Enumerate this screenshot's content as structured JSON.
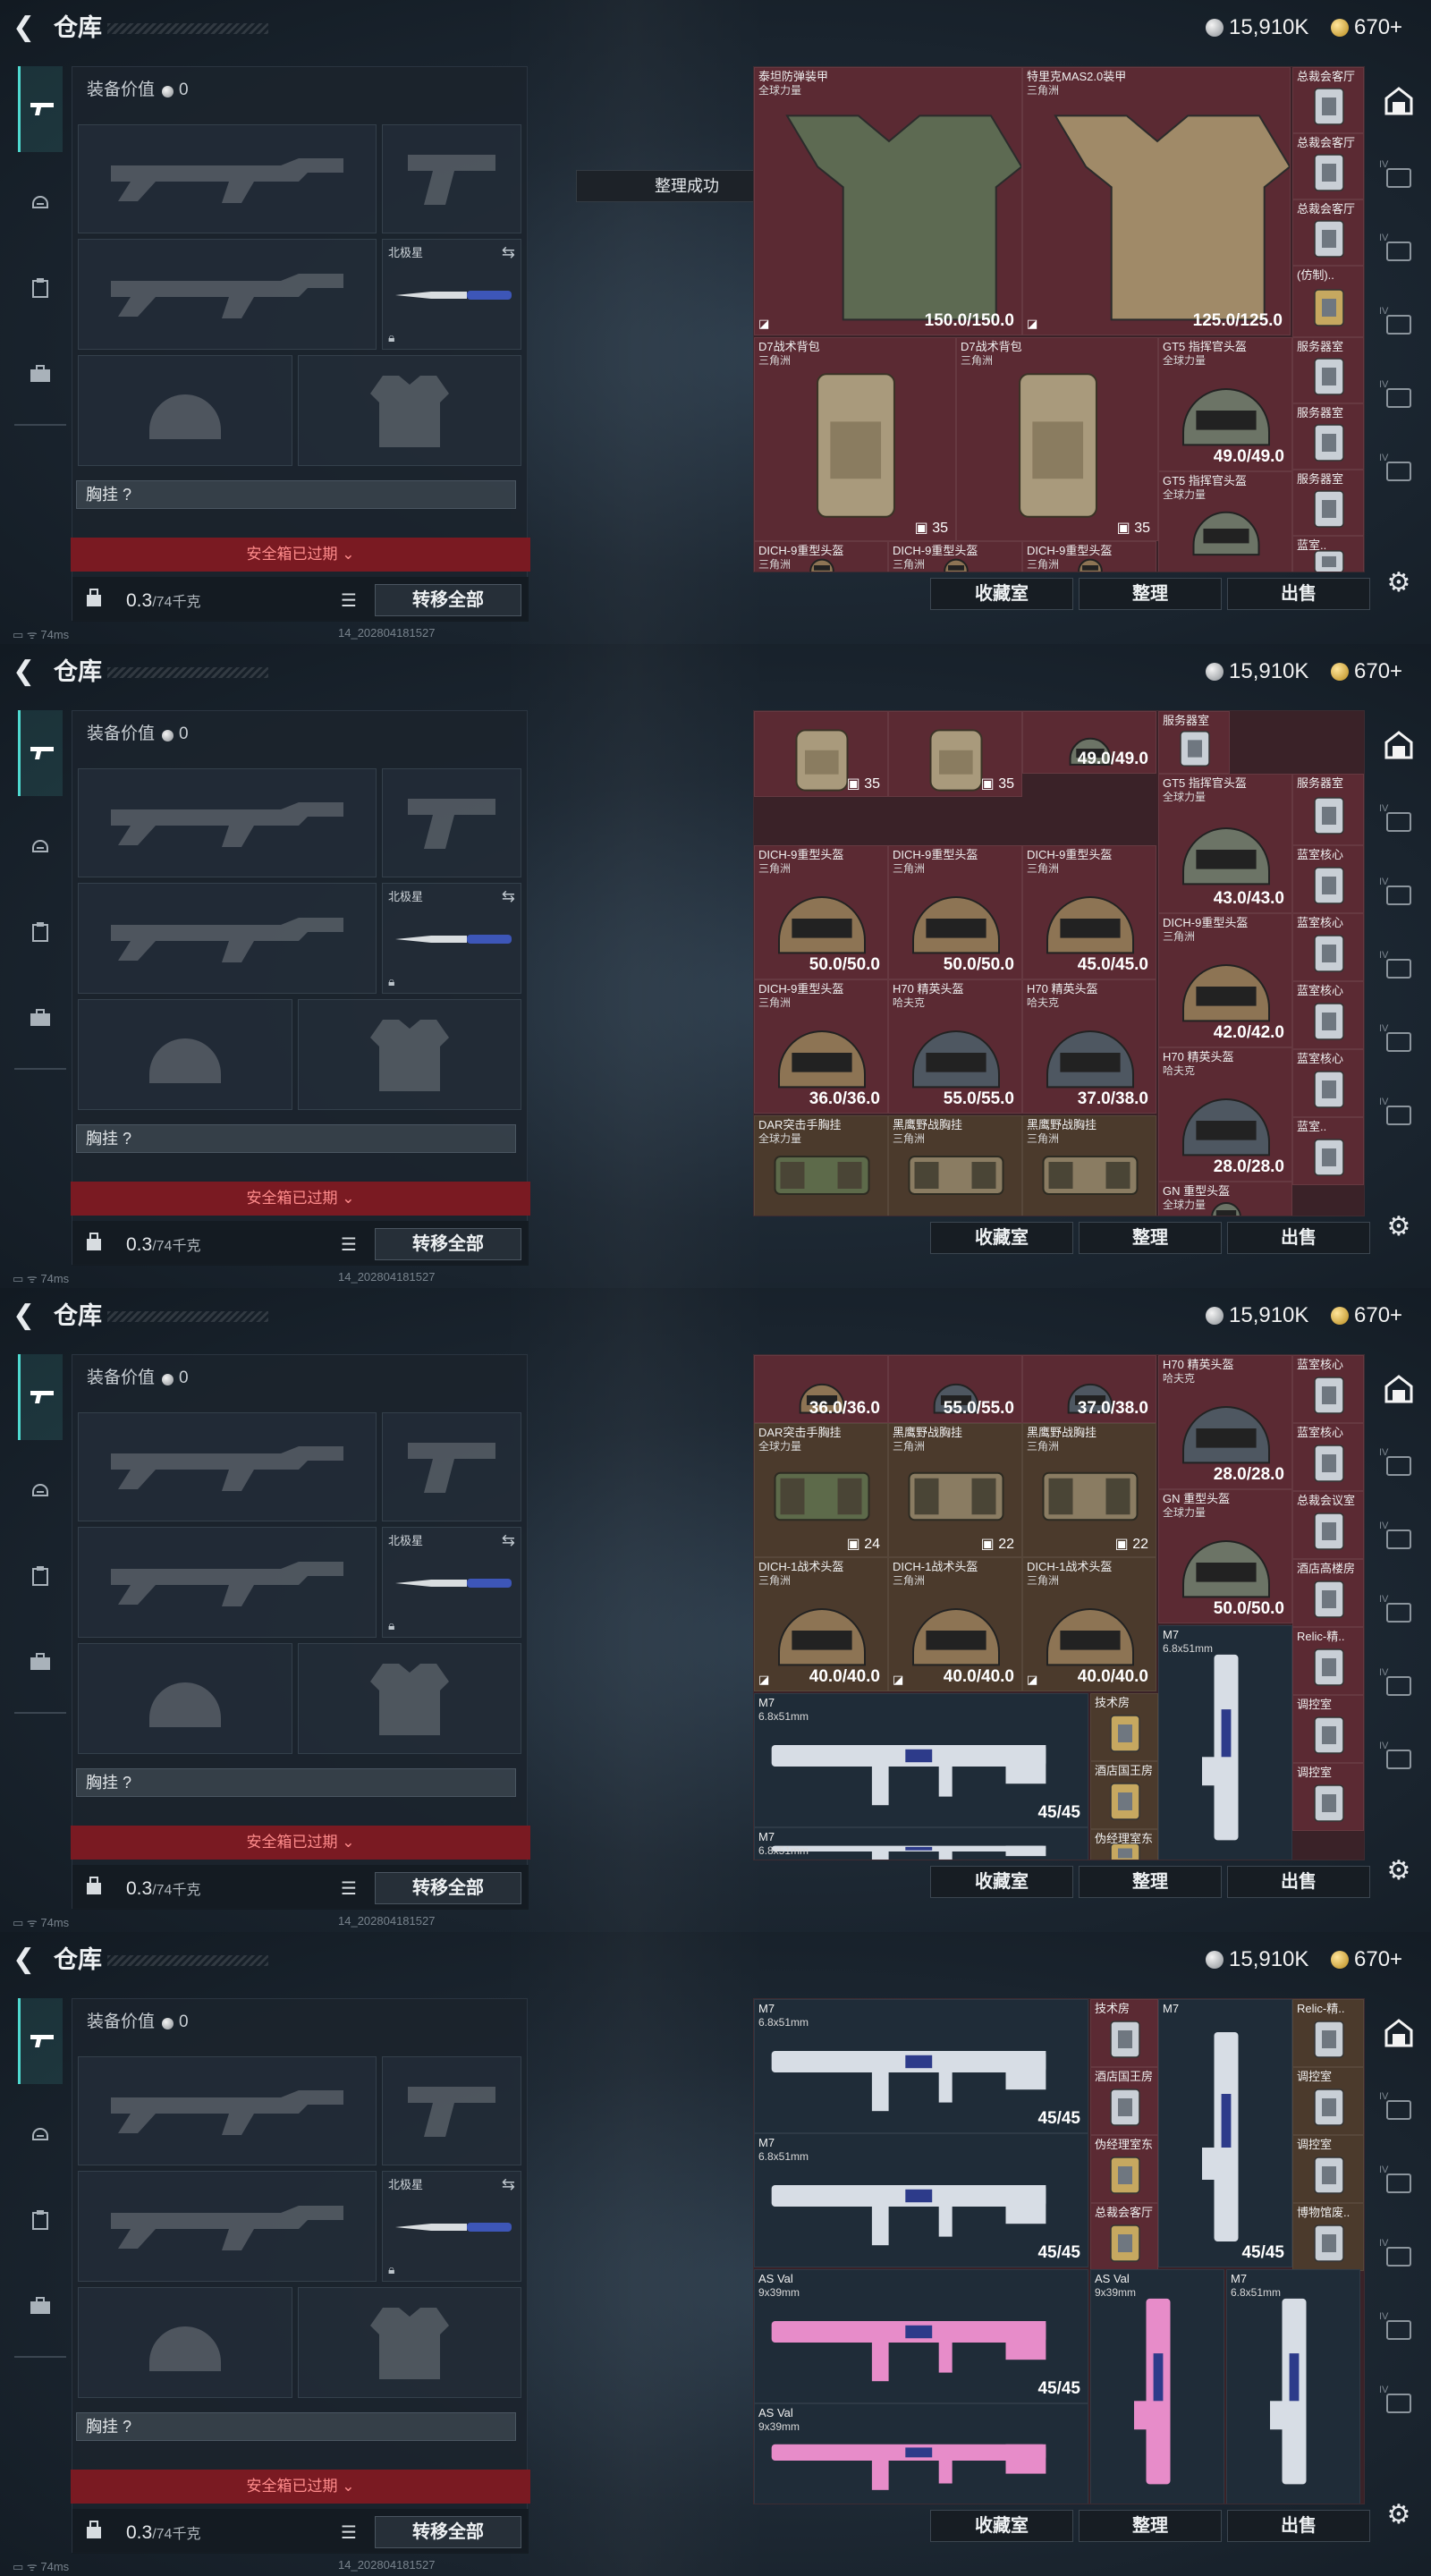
{
  "header": {
    "title": "仓库",
    "currency_silver": "15,910K",
    "currency_gold": "670+",
    "back_label": "❮"
  },
  "loadout": {
    "equip_value_label": "装备价值",
    "equip_value": "0",
    "secondary_name": "北极星",
    "vest_label": "胸挂",
    "vest_value": "?",
    "safebox_label": "安全箱已过期 ⌄",
    "weight": "0.3",
    "weight_max": "/74千克",
    "move_all": "转移全部"
  },
  "toast": "整理成功",
  "status": {
    "ping": "74ms",
    "session_id": "14_202804181527"
  },
  "stash_buttons": {
    "collect": "收藏室",
    "sort": "整理",
    "sell": "出售"
  },
  "rail": {
    "level_label": "IV"
  },
  "frames": [
    {
      "show_toast": true,
      "cells": [
        {
          "name": "泰坦防弹装甲",
          "sub": "全球力量",
          "dur": "150.0/150.0",
          "color": "red",
          "kind": "armor_green",
          "mark": "◪"
        },
        {
          "name": "特里克MAS2.0装甲",
          "sub": "三角洲",
          "dur": "125.0/125.0",
          "color": "red",
          "kind": "armor_tan",
          "mark": "◪"
        },
        {
          "name": "总裁会客厅",
          "sub": "",
          "color": "red",
          "kind": "key"
        },
        {
          "name": "总裁会客厅",
          "sub": "",
          "color": "red",
          "kind": "key"
        },
        {
          "name": "总裁会客厅",
          "sub": "",
          "color": "red",
          "kind": "key"
        },
        {
          "name": "(仿制)..",
          "sub": "",
          "color": "red",
          "kind": "key_gold"
        },
        {
          "name": "D7战术背包",
          "sub": "三角洲",
          "count": "35",
          "color": "red",
          "kind": "backpack"
        },
        {
          "name": "D7战术背包",
          "sub": "三角洲",
          "count": "35",
          "color": "red",
          "kind": "backpack"
        },
        {
          "name": "GT5 指挥官头盔",
          "sub": "全球力量",
          "dur": "49.0/49.0",
          "color": "red",
          "kind": "helmet_green"
        },
        {
          "name": "服务器室",
          "sub": "",
          "color": "red",
          "kind": "key"
        },
        {
          "name": "服务器室",
          "sub": "",
          "color": "red",
          "kind": "key"
        },
        {
          "name": "GT5 指挥官头盔",
          "sub": "全球力量",
          "color": "red",
          "kind": "helmet_green"
        },
        {
          "name": "服务器室",
          "sub": "",
          "color": "red",
          "kind": "key"
        },
        {
          "name": "DICH-9重型头盔",
          "sub": "三角洲",
          "color": "red",
          "kind": "helmet_tan"
        },
        {
          "name": "DICH-9重型头盔",
          "sub": "三角洲",
          "color": "red",
          "kind": "helmet_tan"
        },
        {
          "name": "DICH-9重型头盔",
          "sub": "三角洲",
          "color": "red",
          "kind": "helmet_tan"
        },
        {
          "name": "蓝室..",
          "sub": "",
          "color": "red",
          "kind": "key"
        }
      ]
    },
    {
      "show_toast": false,
      "cells": [
        {
          "name": "",
          "sub": "",
          "count": "35",
          "color": "red",
          "kind": "backpack"
        },
        {
          "name": "",
          "sub": "",
          "count": "35",
          "color": "red",
          "kind": "backpack"
        },
        {
          "name": "",
          "sub": "",
          "dur": "49.0/49.0",
          "color": "red",
          "kind": "helmet_green"
        },
        {
          "name": "服务器室",
          "sub": "",
          "color": "red",
          "kind": "key"
        },
        {
          "name": "GT5 指挥官头盔",
          "sub": "全球力量",
          "dur": "43.0/43.0",
          "color": "red",
          "kind": "helmet_green"
        },
        {
          "name": "服务器室",
          "sub": "",
          "color": "red",
          "kind": "key"
        },
        {
          "name": "DICH-9重型头盔",
          "sub": "三角洲",
          "dur": "50.0/50.0",
          "color": "red",
          "kind": "helmet_tan"
        },
        {
          "name": "DICH-9重型头盔",
          "sub": "三角洲",
          "dur": "50.0/50.0",
          "color": "red",
          "kind": "helmet_tan"
        },
        {
          "name": "DICH-9重型头盔",
          "sub": "三角洲",
          "dur": "45.0/45.0",
          "color": "red",
          "kind": "helmet_tan"
        },
        {
          "name": "蓝室核心",
          "sub": "",
          "color": "red",
          "kind": "key"
        },
        {
          "name": "DICH-9重型头盔",
          "sub": "三角洲",
          "dur": "42.0/42.0",
          "color": "red",
          "kind": "helmet_tan"
        },
        {
          "name": "蓝室核心",
          "sub": "",
          "color": "red",
          "kind": "key"
        },
        {
          "name": "DICH-9重型头盔",
          "sub": "三角洲",
          "dur": "36.0/36.0",
          "color": "red",
          "kind": "helmet_tan"
        },
        {
          "name": "H70 精英头盔",
          "sub": "哈夫克",
          "dur": "55.0/55.0",
          "color": "red",
          "kind": "helmet_dark"
        },
        {
          "name": "H70 精英头盔",
          "sub": "哈夫克",
          "dur": "37.0/38.0",
          "color": "red",
          "kind": "helmet_dark"
        },
        {
          "name": "蓝室核心",
          "sub": "",
          "color": "red",
          "kind": "key"
        },
        {
          "name": "H70 精英头盔",
          "sub": "哈夫克",
          "dur": "28.0/28.0",
          "color": "red",
          "kind": "helmet_dark"
        },
        {
          "name": "蓝室核心",
          "sub": "",
          "color": "red",
          "kind": "key"
        },
        {
          "name": "DAR突击手胸挂",
          "sub": "全球力量",
          "color": "brown",
          "kind": "rig_green"
        },
        {
          "name": "黑鹰野战胸挂",
          "sub": "三角洲",
          "color": "brown",
          "kind": "rig_tan"
        },
        {
          "name": "黑鹰野战胸挂",
          "sub": "三角洲",
          "color": "brown",
          "kind": "rig_tan"
        },
        {
          "name": "GN 重型头盔",
          "sub": "全球力量",
          "color": "red",
          "kind": "helmet_green"
        },
        {
          "name": "蓝室..",
          "sub": "",
          "color": "red",
          "kind": "key"
        }
      ]
    },
    {
      "show_toast": false,
      "cells": [
        {
          "name": "",
          "sub": "",
          "dur": "36.0/36.0",
          "color": "red",
          "kind": "helmet_tan"
        },
        {
          "name": "",
          "sub": "",
          "dur": "55.0/55.0",
          "color": "red",
          "kind": "helmet_dark"
        },
        {
          "name": "",
          "sub": "",
          "dur": "37.0/38.0",
          "color": "red",
          "kind": "helmet_dark"
        },
        {
          "name": "H70 精英头盔",
          "sub": "哈夫克",
          "dur": "28.0/28.0",
          "color": "red",
          "kind": "helmet_dark"
        },
        {
          "name": "蓝室核心",
          "sub": "",
          "color": "red",
          "kind": "key"
        },
        {
          "name": "DAR突击手胸挂",
          "sub": "全球力量",
          "count": "24",
          "color": "brown",
          "kind": "rig_green"
        },
        {
          "name": "黑鹰野战胸挂",
          "sub": "三角洲",
          "count": "22",
          "color": "brown",
          "kind": "rig_tan"
        },
        {
          "name": "黑鹰野战胸挂",
          "sub": "三角洲",
          "count": "22",
          "color": "brown",
          "kind": "rig_tan"
        },
        {
          "name": "蓝室核心",
          "sub": "",
          "color": "red",
          "kind": "key"
        },
        {
          "name": "GN 重型头盔",
          "sub": "全球力量",
          "dur": "50.0/50.0",
          "color": "red",
          "kind": "helmet_green"
        },
        {
          "name": "总裁会议室",
          "sub": "",
          "color": "red",
          "kind": "key"
        },
        {
          "name": "DICH-1战术头盔",
          "sub": "三角洲",
          "dur": "40.0/40.0",
          "color": "brown",
          "kind": "helmet_tan",
          "mark": "◪"
        },
        {
          "name": "DICH-1战术头盔",
          "sub": "三角洲",
          "dur": "40.0/40.0",
          "color": "brown",
          "kind": "helmet_tan",
          "mark": "◪"
        },
        {
          "name": "DICH-1战术头盔",
          "sub": "三角洲",
          "dur": "40.0/40.0",
          "color": "brown",
          "kind": "helmet_tan",
          "mark": "◪"
        },
        {
          "name": "酒店高楼房",
          "sub": "",
          "color": "red",
          "kind": "key"
        },
        {
          "name": "M7",
          "sub": "6.8x51mm",
          "dur": "45/45",
          "color": "navy",
          "kind": "rifle_white"
        },
        {
          "name": "技术房",
          "sub": "",
          "color": "brown",
          "kind": "key_gold"
        },
        {
          "name": "M7",
          "sub": "6.8x51mm",
          "color": "navy",
          "kind": "rifle_white_v"
        },
        {
          "name": "Relic-精..",
          "sub": "",
          "color": "red",
          "kind": "key"
        },
        {
          "name": "酒店国王房",
          "sub": "",
          "color": "brown",
          "kind": "key_gold"
        },
        {
          "name": "调控室",
          "sub": "",
          "color": "red",
          "kind": "key"
        },
        {
          "name": "伪经理室东",
          "sub": "",
          "color": "brown",
          "kind": "key_gold"
        },
        {
          "name": "调控室",
          "sub": "",
          "color": "red",
          "kind": "key"
        },
        {
          "name": "M7",
          "sub": "6.8x51mm",
          "color": "navy",
          "kind": "rifle_white"
        }
      ]
    },
    {
      "show_toast": false,
      "cells": [
        {
          "name": "M7",
          "sub": "6.8x51mm",
          "dur": "45/45",
          "color": "navy",
          "kind": "rifle_white"
        },
        {
          "name": "技术房",
          "sub": "",
          "color": "red",
          "kind": "key"
        },
        {
          "name": "Relic-精..",
          "sub": "",
          "color": "brown",
          "kind": "key"
        },
        {
          "name": "M7",
          "sub": "",
          "dur": "45/45",
          "color": "navy",
          "kind": "rifle_white_v"
        },
        {
          "name": "酒店国王房",
          "sub": "",
          "color": "red",
          "kind": "key"
        },
        {
          "name": "调控室",
          "sub": "",
          "color": "brown",
          "kind": "key"
        },
        {
          "name": "M7",
          "sub": "6.8x51mm",
          "dur": "45/45",
          "color": "navy",
          "kind": "rifle_white"
        },
        {
          "name": "伪经理室东",
          "sub": "",
          "color": "red",
          "kind": "key_gold"
        },
        {
          "name": "调控室",
          "sub": "",
          "color": "brown",
          "kind": "key"
        },
        {
          "name": "总裁会客厅",
          "sub": "",
          "color": "red",
          "kind": "key_gold"
        },
        {
          "name": "博物馆废..",
          "sub": "",
          "color": "brown",
          "kind": "key"
        },
        {
          "name": "AS Val",
          "sub": "9x39mm",
          "dur": "45/45",
          "color": "navy",
          "kind": "rifle_pink"
        },
        {
          "name": "AS Val",
          "sub": "9x39mm",
          "color": "navy",
          "kind": "rifle_pink_v"
        },
        {
          "name": "M7",
          "sub": "6.8x51mm",
          "color": "navy",
          "kind": "rifle_white_v"
        },
        {
          "name": "AS Val",
          "sub": "9x39mm",
          "color": "navy",
          "kind": "rifle_pink"
        }
      ]
    }
  ]
}
